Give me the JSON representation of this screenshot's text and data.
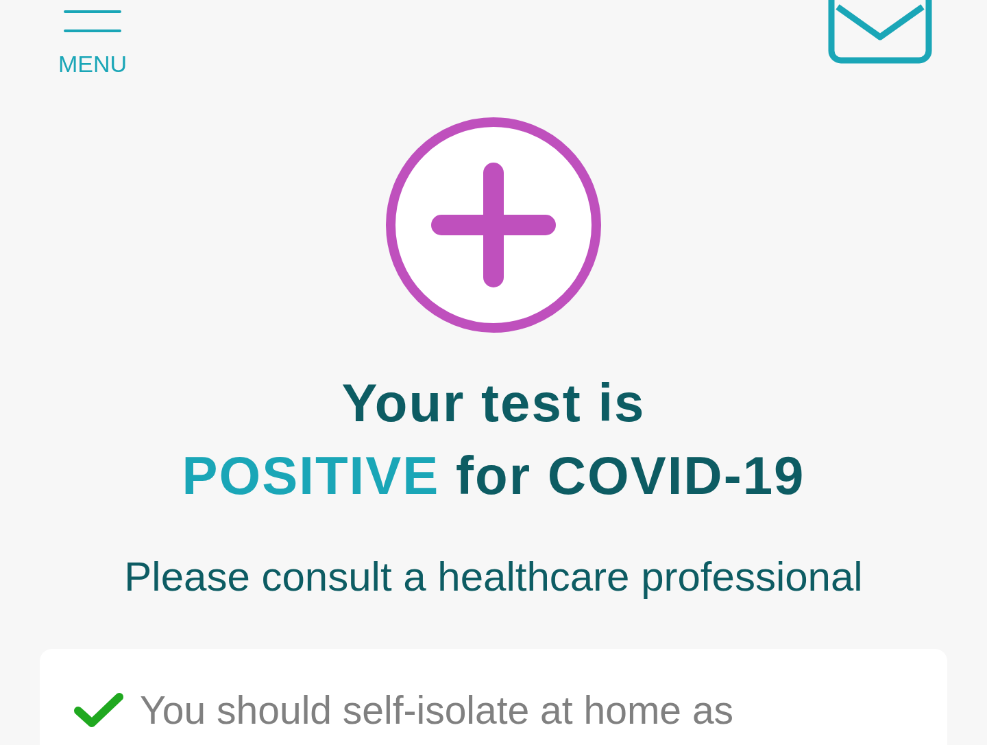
{
  "header": {
    "menu_label": "MENU"
  },
  "result": {
    "line1": "Your test is",
    "highlight": "POSITIVE",
    "rest": "for COVID-19"
  },
  "subtitle": "Please consult a healthcare professional",
  "advice": [
    {
      "text": "You should self-isolate at home as",
      "checked": true
    }
  ]
}
